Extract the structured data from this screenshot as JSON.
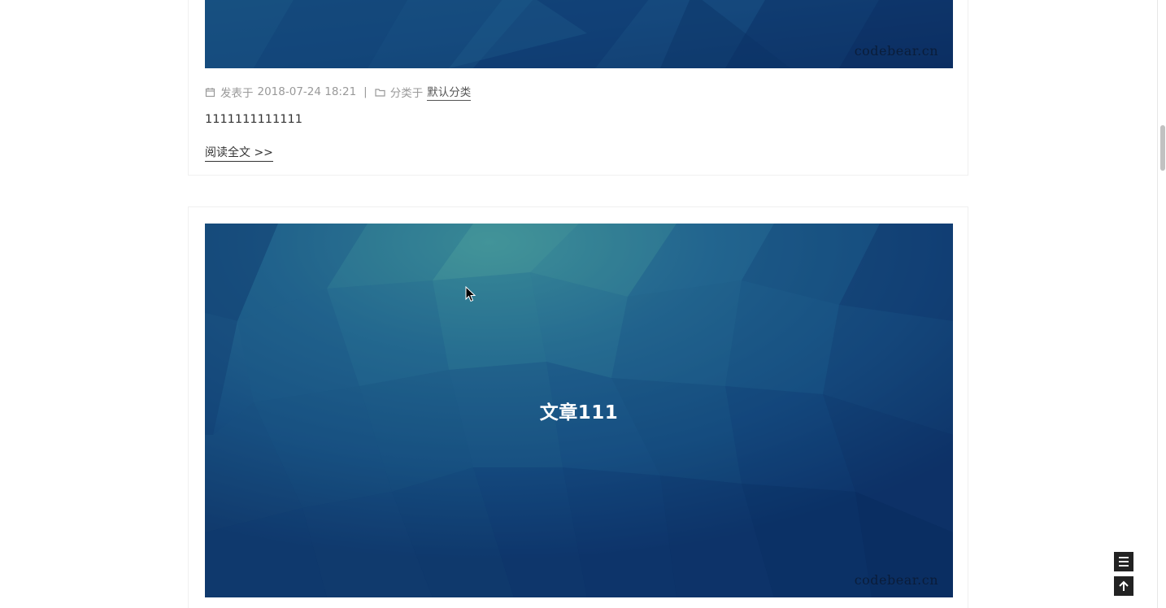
{
  "posts": [
    {
      "watermark": "codebear.cn",
      "meta": {
        "posted_label": "发表于",
        "posted_date": "2018-07-24 18:21",
        "separator": "|",
        "category_label": "分类于",
        "category": "默认分类"
      },
      "excerpt": "1111111111111",
      "read_more": "阅读全文 >>"
    },
    {
      "cover_title": "文章111",
      "watermark": "codebear.cn"
    }
  ],
  "colors": {
    "cover_dark": "#0d2f63",
    "cover_mid": "#1a5683",
    "cover_light": "#3e8f98",
    "button_bg": "#222222"
  },
  "icons": {
    "calendar": "calendar-icon",
    "folder": "folder-icon",
    "menu": "menu-icon",
    "back_to_top": "arrow-up-icon"
  }
}
